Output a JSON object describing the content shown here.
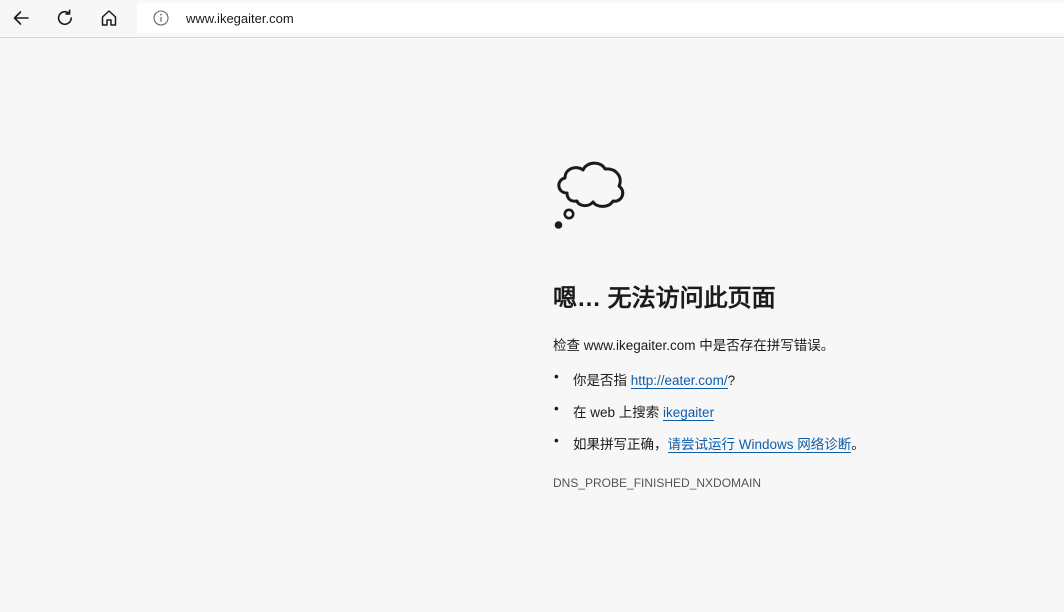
{
  "browser": {
    "url": "www.ikegaiter.com",
    "buttons": {
      "back": "back-arrow-icon",
      "refresh": "refresh-icon",
      "home": "home-icon",
      "site_info": "info-icon"
    }
  },
  "error_page": {
    "icon": "thought-cloud-icon",
    "heading": "嗯… 无法访问此页面",
    "check_text": "检查 www.ikegaiter.com 中是否存在拼写错误。",
    "suggestions": [
      {
        "prefix": "你是否指 ",
        "link": "http://eater.com/",
        "suffix": "?"
      },
      {
        "prefix": "在 web 上搜索 ",
        "link": "ikegaiter",
        "suffix": ""
      },
      {
        "prefix": "如果拼写正确，",
        "link": "请尝试运行 Windows 网络诊断",
        "suffix": "。"
      }
    ],
    "bullet": "•",
    "error_code": "DNS_PROBE_FINISHED_NXDOMAIN"
  },
  "colors": {
    "page_background": "#f7f7f7",
    "link": "#0f5ea8",
    "text": "#1b1b1b",
    "muted": "#555555"
  }
}
